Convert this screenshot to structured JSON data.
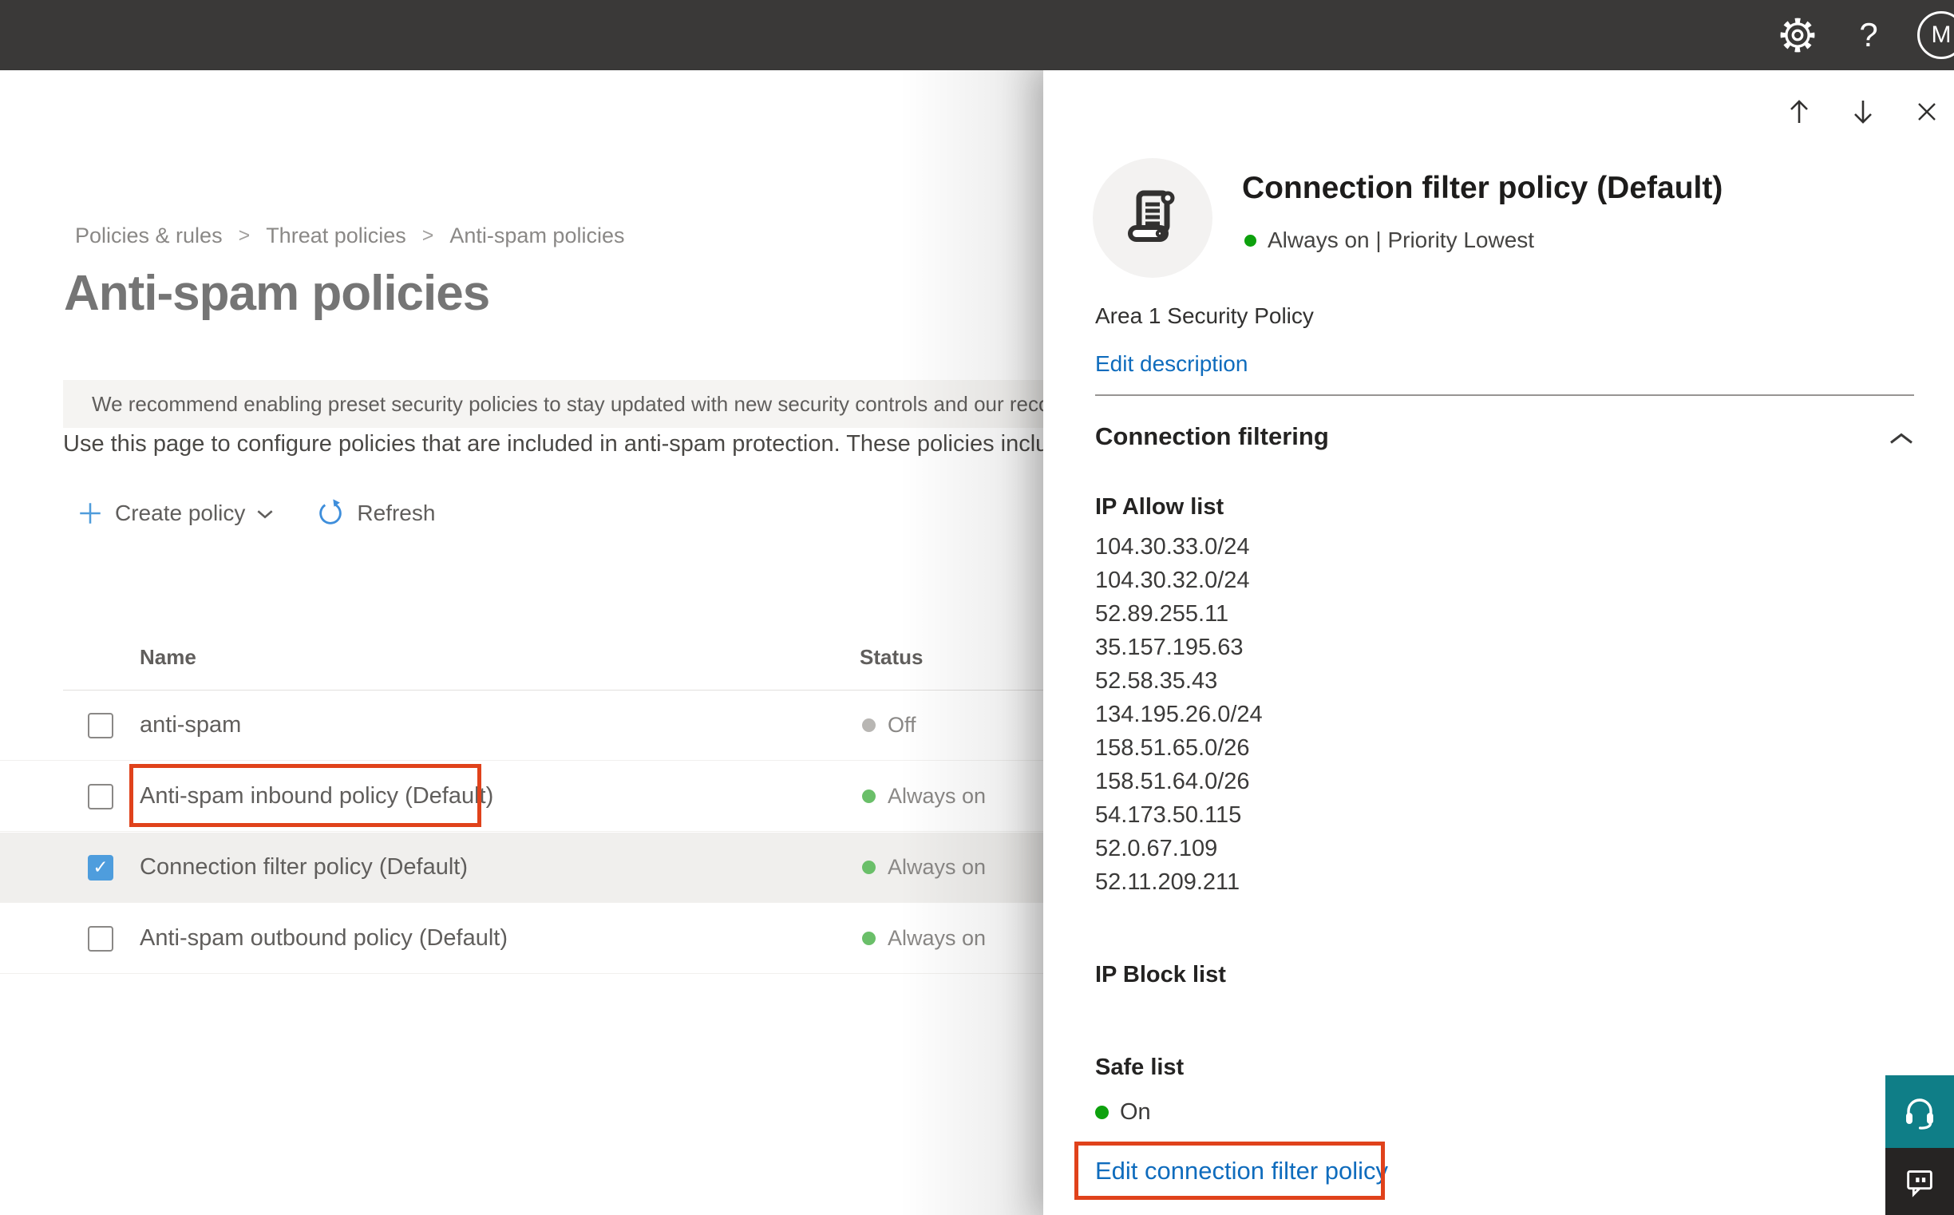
{
  "topbar": {
    "help_label": "?",
    "avatar_initial": "M"
  },
  "breadcrumb": {
    "items": [
      "Policies & rules",
      "Threat policies",
      "Anti-spam policies"
    ],
    "separator": ">"
  },
  "page": {
    "title": "Anti-spam policies",
    "banner_text": "We recommend enabling preset security policies to stay updated with new security controls and our recomme",
    "description": "Use this page to configure policies that are included in anti-spam protection. These policies include",
    "toolbar": {
      "create_label": "Create policy",
      "refresh_label": "Refresh"
    }
  },
  "table": {
    "columns": [
      "Name",
      "Status"
    ],
    "rows": [
      {
        "name": "anti-spam",
        "status": "Off",
        "dot_color": "#b8b6b3",
        "checked": false
      },
      {
        "name": "Anti-spam inbound policy (Default)",
        "status": "Always on",
        "dot_color": "#6abf69",
        "checked": false
      },
      {
        "name": "Connection filter policy (Default)",
        "status": "Always on",
        "dot_color": "#6abf69",
        "checked": true
      },
      {
        "name": "Anti-spam outbound policy (Default)",
        "status": "Always on",
        "dot_color": "#6abf69",
        "checked": false
      }
    ]
  },
  "flyout": {
    "title": "Connection filter policy (Default)",
    "status_line": "Always on | Priority Lowest",
    "status_dot_color": "#0da10d",
    "description": "Area 1 Security Policy",
    "edit_description_label": "Edit description",
    "section_title": "Connection filtering",
    "ip_allow": {
      "heading": "IP Allow list",
      "items": [
        "104.30.33.0/24",
        "104.30.32.0/24",
        "52.89.255.11",
        "35.157.195.63",
        "52.58.35.43",
        "134.195.26.0/24",
        "158.51.65.0/26",
        "158.51.64.0/26",
        "54.173.50.115",
        "52.0.67.109",
        "52.11.209.211"
      ]
    },
    "ip_block": {
      "heading": "IP Block list"
    },
    "safe_list": {
      "heading": "Safe list",
      "status": "On",
      "dot_color": "#0da10d"
    },
    "edit_policy_label": "Edit connection filter policy"
  },
  "colors": {
    "topbar": "#3a3938",
    "accent_link": "#0f6cbd",
    "toolbar_icon_blue": "#4f9cdb",
    "annotation_red": "#e0421b",
    "selected_row": "#f0efed",
    "checkbox_checked": "#4e9ddd",
    "banner_bg": "#f5f4f2",
    "support_teal": "#0f7e87",
    "feedback_dark": "#262423"
  }
}
